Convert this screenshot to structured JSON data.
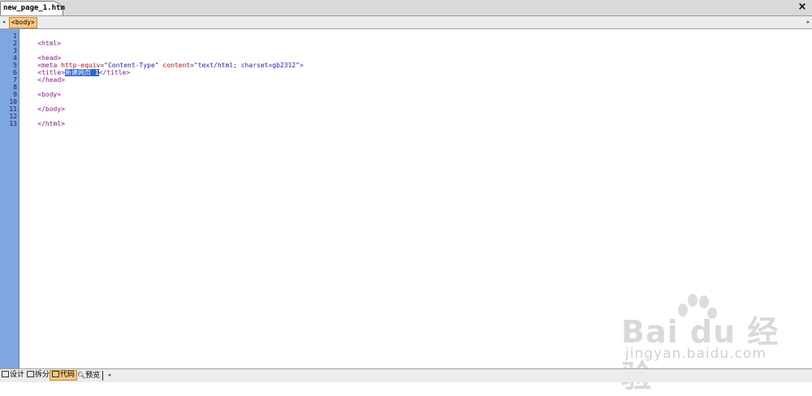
{
  "tab": {
    "title": "new_page_1.htm",
    "close_label": "×"
  },
  "tagbar": {
    "left_arrow": "◂",
    "right_arrow": "▸",
    "selected_tag": "<body>"
  },
  "gutter": {
    "line_numbers": [
      "1",
      "2",
      "3",
      "4",
      "5",
      "6",
      "7",
      "8",
      "9",
      "10",
      "11",
      "12",
      "13"
    ]
  },
  "code": {
    "line1": "<html>",
    "line3": "<head>",
    "line4_tag": "<meta ",
    "line4_attr1": "http-equiv",
    "line4_val1": "=\"Content-Type\" ",
    "line4_attr2": "content",
    "line4_val2": "=\"text/html; charset=gb2312\"",
    "line4_end": ">",
    "line5_open": "<title>",
    "line5_selected": "新建网页 1",
    "line5_close": "</title>",
    "line6": "</head>",
    "line8": "<body>",
    "line10": "</body>",
    "line12": "</html>"
  },
  "watermark": {
    "brand": "Bai du 经验",
    "url": "jingyan.baidu.com"
  },
  "viewbar": {
    "design": "设计",
    "split": "拆分",
    "code": "代码",
    "preview": "预览",
    "scroll_left": "◂"
  },
  "colors": {
    "gutter": "#7fa6de",
    "tag": "#8a1a8a",
    "attribute": "#c01010",
    "value": "#1c1cb0",
    "selection": "#3366cc",
    "active_chip": "#f7c882"
  }
}
